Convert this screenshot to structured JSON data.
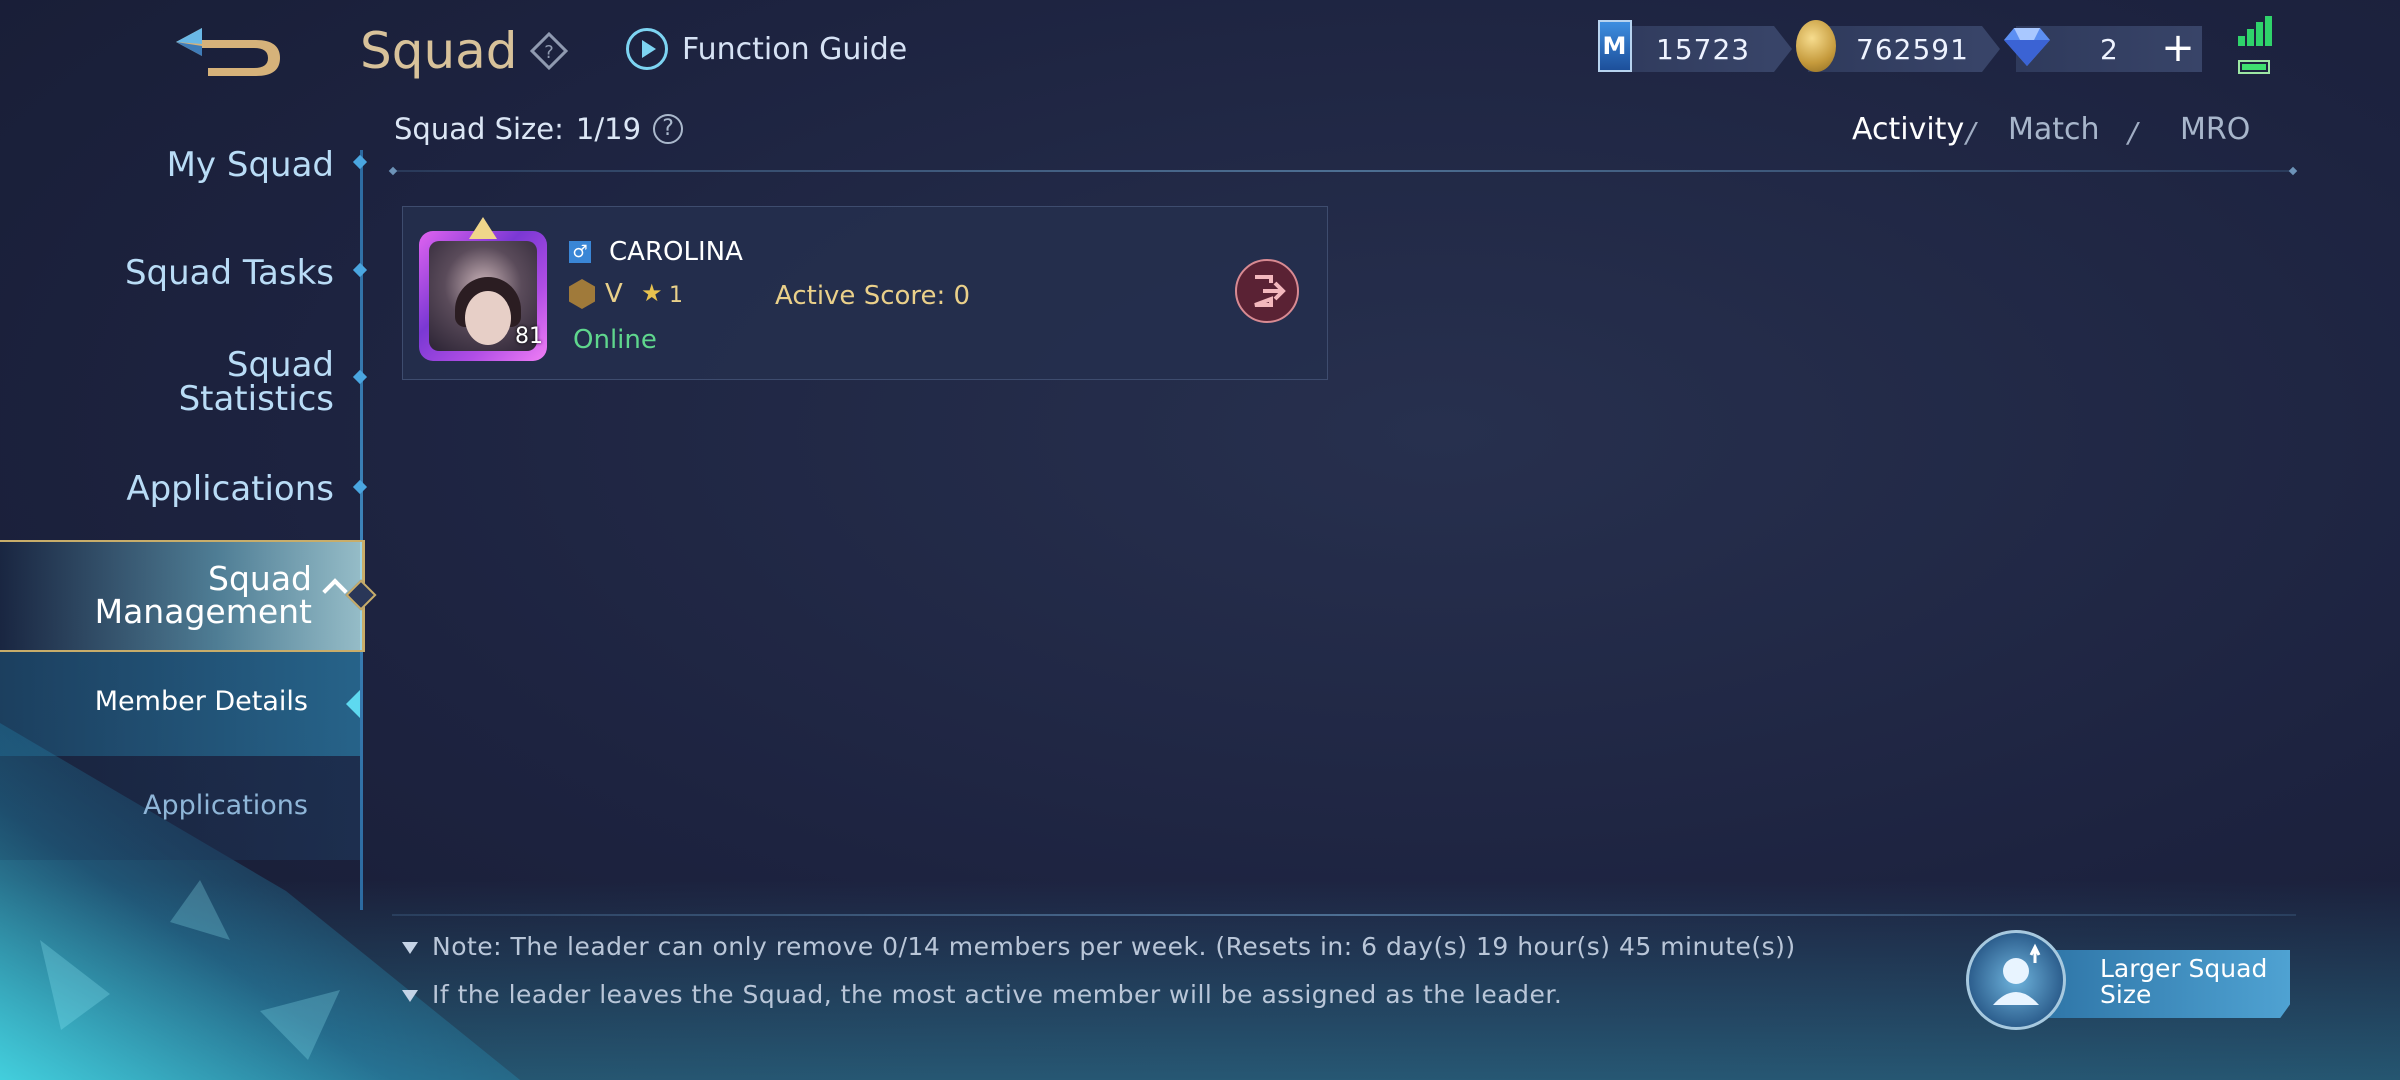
{
  "header": {
    "title": "Squad",
    "function_guide": "Function Guide"
  },
  "currencies": [
    {
      "name": "battle-points",
      "value": "15723"
    },
    {
      "name": "gold",
      "value": "762591"
    },
    {
      "name": "diamonds",
      "value": "2"
    }
  ],
  "sidebar": {
    "items": [
      {
        "label": "My Squad"
      },
      {
        "label": "Squad Tasks"
      },
      {
        "label": "Squad\nStatistics"
      },
      {
        "label": "Applications"
      },
      {
        "label": "Squad\nManagement"
      }
    ],
    "sub_items": [
      {
        "label": "Member Details",
        "active": true
      },
      {
        "label": "Applications",
        "active": false
      }
    ]
  },
  "content": {
    "squad_size_label": "Squad Size:",
    "squad_size_value": "1/19",
    "sort_tabs": [
      {
        "label": "Activity",
        "active": true
      },
      {
        "label": "Match",
        "active": false
      },
      {
        "label": "MRO",
        "active": false
      }
    ],
    "sort_separator": "/",
    "members": [
      {
        "name": "CAROLINA",
        "level": "81",
        "rank": "V",
        "stars": "1",
        "active_score": "Active Score: 0",
        "status": "Online"
      }
    ]
  },
  "notes": [
    "Note: The leader can only remove 0/14 members per week. (Resets in: 6 day(s) 19 hour(s) 45 minute(s))",
    "If the leader leaves the Squad, the most active member will be assigned as the leader."
  ],
  "larger_squad_button": "Larger Squad\nSize",
  "colors": {
    "title_gold": "#d8c29a",
    "accent_cyan": "#7dd4f2",
    "online_green": "#5fd68d",
    "score_gold": "#ead08a"
  }
}
